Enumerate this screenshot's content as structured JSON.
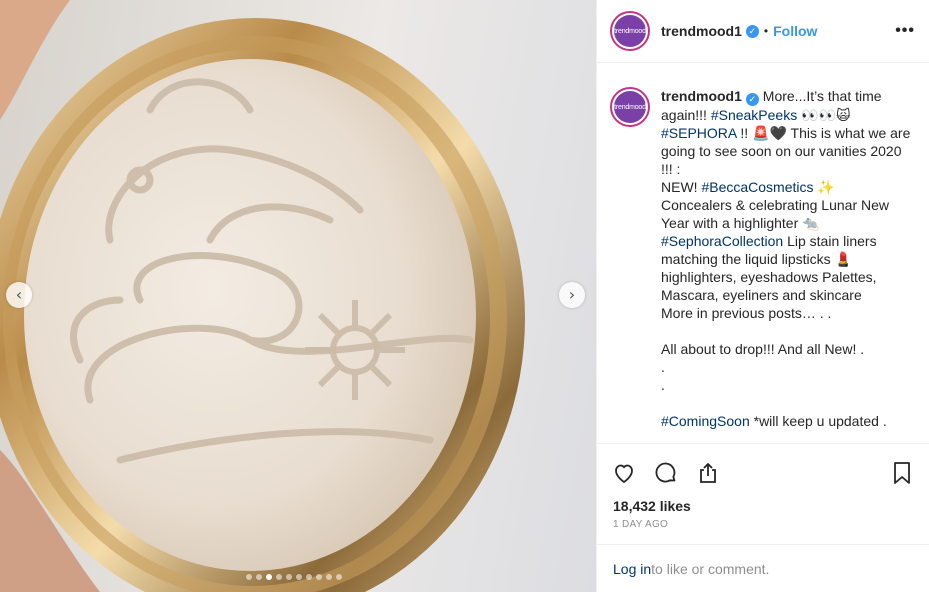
{
  "post": {
    "username": "trendmood1",
    "follow_label": "Follow",
    "dot_separator": "•",
    "more_label": "•••",
    "avatar_text": "trendmood"
  },
  "caption": {
    "username": "trendmood1",
    "segments": [
      {
        "t": "text",
        "v": " More...It’s that time again!!! "
      },
      {
        "t": "tag",
        "v": "#SneakPeeks"
      },
      {
        "t": "text",
        "v": " 👀👀🙀\n"
      },
      {
        "t": "tag",
        "v": "#SEPHORA"
      },
      {
        "t": "text",
        "v": " !! 🚨🖤 This is what we are going to see soon on our vanities 2020 !!! :\nNEW! "
      },
      {
        "t": "tag",
        "v": "#BeccaCosmetics"
      },
      {
        "t": "text",
        "v": " ✨\nConcealers & celebrating Lunar New Year with a highlighter 🐀\n"
      },
      {
        "t": "tag",
        "v": "#SephoraCollection"
      },
      {
        "t": "text",
        "v": " Lip stain liners matching the liquid lipsticks 💄\nhighlighters, eyeshadows Palettes, Mascara, eyeliners and skincare\nMore in previous posts… . .\n\nAll about to drop!!! And all New! .\n.\n.\n\n"
      },
      {
        "t": "tag",
        "v": "#ComingSoon"
      },
      {
        "t": "text",
        "v": " *will keep u updated ."
      }
    ]
  },
  "stats": {
    "likes": "18,432 likes",
    "timestamp": "1 DAY AGO"
  },
  "comment": {
    "login_link": "Log in",
    "rest": " to like or comment."
  },
  "carousel": {
    "prev_glyph": "‹",
    "next_glyph": "›",
    "slide_count": 10,
    "active_index": 2
  },
  "icons": {
    "like": "heart-icon",
    "comment": "comment-icon",
    "share": "share-icon",
    "save": "bookmark-icon",
    "verified": "verified-badge-icon"
  },
  "colors": {
    "link_blue": "#3897f0",
    "hashtag": "#003569",
    "avatar_ring": "#c13584",
    "avatar_fill": "#7b3fa8",
    "muted": "#8e8e8e"
  }
}
